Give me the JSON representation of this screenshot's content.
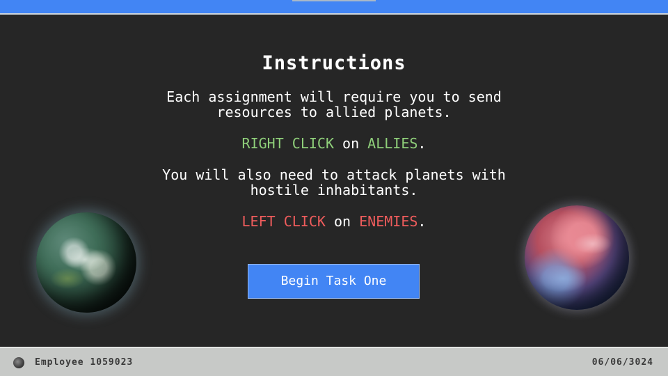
{
  "colors": {
    "accent": "#4285f4",
    "ally": "#8fcf7a",
    "enemy": "#ef5c5c",
    "background": "#262626",
    "status_bar": "#c7c9c7"
  },
  "instructions": {
    "title": "Instructions",
    "line1": "Each assignment will require you to send",
    "line2": "resources to allied planets.",
    "right_click_action": "RIGHT CLICK",
    "right_click_on": "on",
    "right_click_target": "ALLIES",
    "right_click_period": ".",
    "line3": "You will also need to attack planets with",
    "line4": "hostile inhabitants.",
    "left_click_action": "LEFT CLICK",
    "left_click_on": "on",
    "left_click_target": "ENEMIES",
    "left_click_period": ".",
    "button_label": "Begin Task One"
  },
  "planets": {
    "left_icon": "earth-planet-icon",
    "right_icon": "red-planet-icon"
  },
  "status_bar": {
    "avatar_icon": "employee-avatar-icon",
    "employee": "Employee 1059023",
    "date": "06/06/3024"
  }
}
